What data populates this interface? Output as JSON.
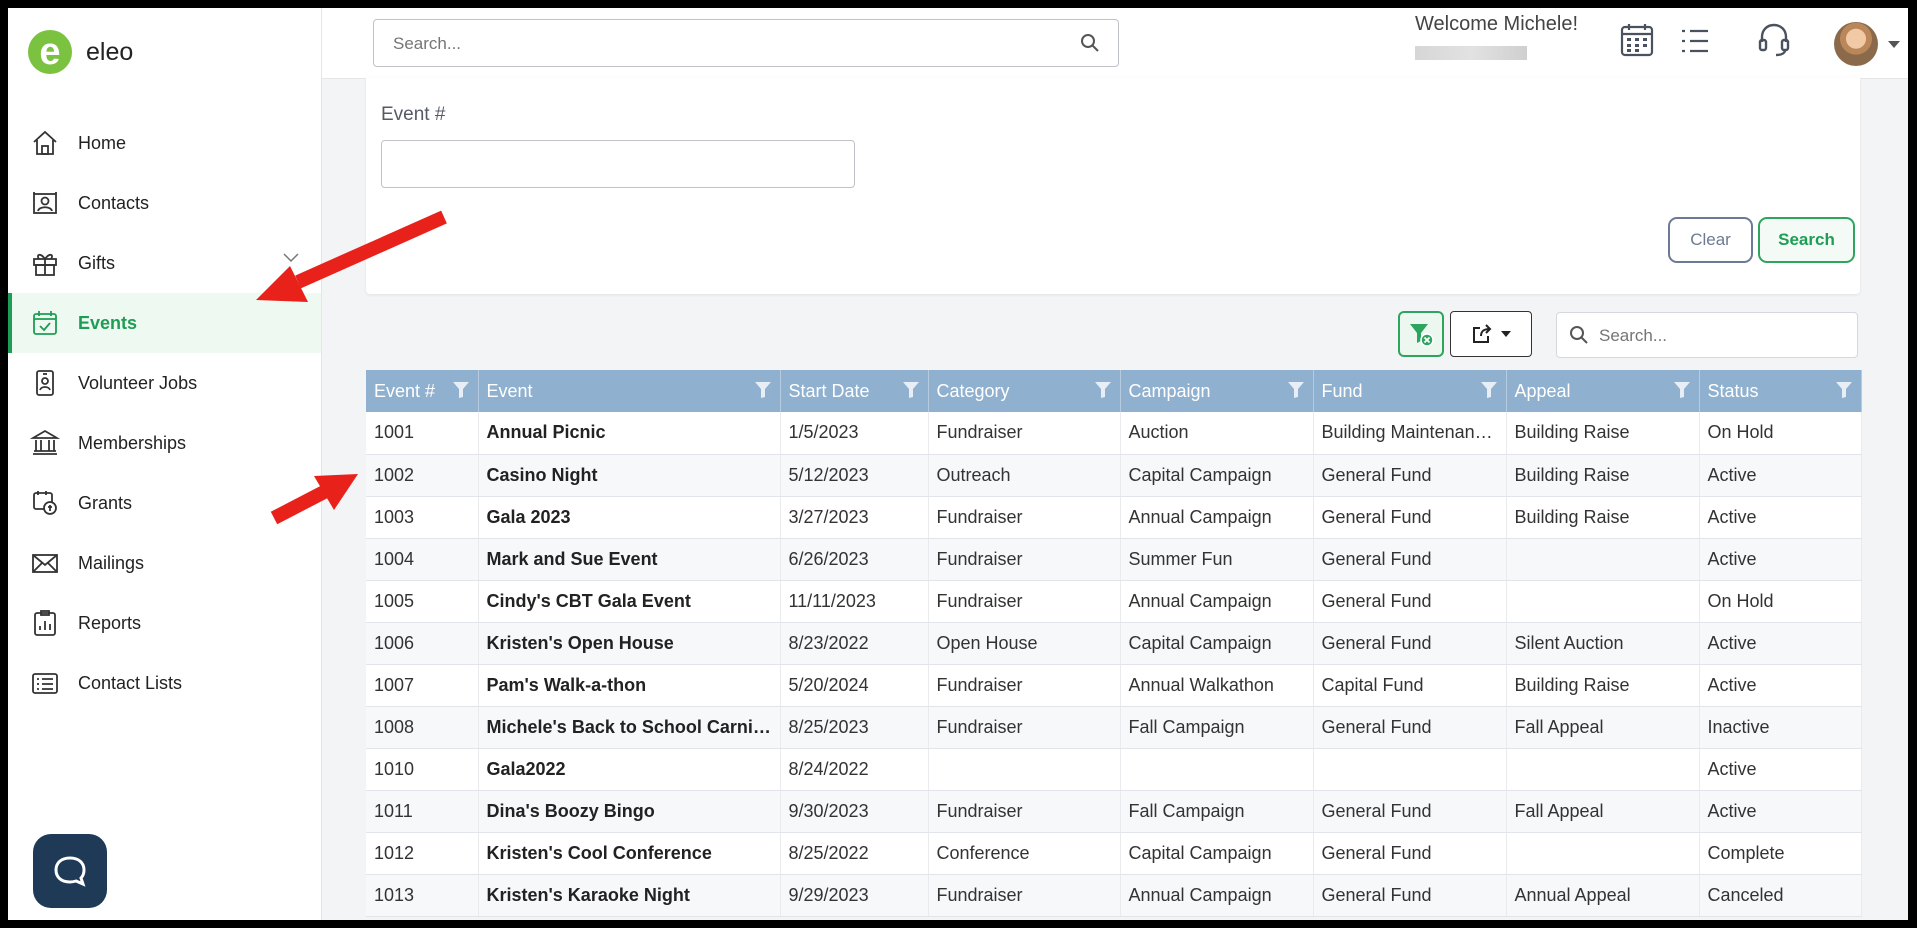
{
  "app": {
    "logo_text": "eleo",
    "logo_letter": "e"
  },
  "search": {
    "placeholder": "Search..."
  },
  "header": {
    "welcome": "Welcome Michele!"
  },
  "sidebar": {
    "items": [
      {
        "label": "Home",
        "icon": "home-icon"
      },
      {
        "label": "Contacts",
        "icon": "contacts-icon"
      },
      {
        "label": "Gifts",
        "icon": "gift-icon"
      },
      {
        "label": "Events",
        "icon": "calendar-check-icon",
        "active": true
      },
      {
        "label": "Volunteer Jobs",
        "icon": "badge-icon"
      },
      {
        "label": "Memberships",
        "icon": "bank-icon"
      },
      {
        "label": "Grants",
        "icon": "grant-icon"
      },
      {
        "label": "Mailings",
        "icon": "mail-icon"
      },
      {
        "label": "Reports",
        "icon": "report-icon"
      },
      {
        "label": "Contact Lists",
        "icon": "list-icon"
      }
    ]
  },
  "filter": {
    "event_label": "Event #",
    "event_value": "",
    "clear_label": "Clear",
    "search_label": "Search"
  },
  "grid_search": {
    "placeholder": "Search..."
  },
  "grid": {
    "columns": [
      "Event #",
      "Event",
      "Start Date",
      "Category",
      "Campaign",
      "Fund",
      "Appeal",
      "Status"
    ],
    "rows": [
      [
        "1001",
        "Annual Picnic",
        "1/5/2023",
        "Fundraiser",
        "Auction",
        "Building Maintenanc...",
        "Building Raise",
        "On Hold"
      ],
      [
        "1002",
        "Casino Night",
        "5/12/2023",
        "Outreach",
        "Capital Campaign",
        "General Fund",
        "Building Raise",
        "Active"
      ],
      [
        "1003",
        "Gala 2023",
        "3/27/2023",
        "Fundraiser",
        "Annual Campaign",
        "General Fund",
        "Building Raise",
        "Active"
      ],
      [
        "1004",
        "Mark and Sue Event",
        "6/26/2023",
        "Fundraiser",
        "Summer Fun",
        "General Fund",
        "",
        "Active"
      ],
      [
        "1005",
        "Cindy's CBT Gala Event",
        "11/11/2023",
        "Fundraiser",
        "Annual Campaign",
        "General Fund",
        "",
        "On Hold"
      ],
      [
        "1006",
        "Kristen's Open House",
        "8/23/2022",
        "Open House",
        "Capital Campaign",
        "General Fund",
        "Silent Auction",
        "Active"
      ],
      [
        "1007",
        "Pam's Walk-a-thon",
        "5/20/2024",
        "Fundraiser",
        "Annual Walkathon",
        "Capital Fund",
        "Building Raise",
        "Active"
      ],
      [
        "1008",
        "Michele's Back to School Carnival",
        "8/25/2023",
        "Fundraiser",
        "Fall Campaign",
        "General Fund",
        "Fall Appeal",
        "Inactive"
      ],
      [
        "1010",
        "Gala2022",
        "8/24/2022",
        "",
        "",
        "",
        "",
        "Active"
      ],
      [
        "1011",
        "Dina's Boozy Bingo",
        "9/30/2023",
        "Fundraiser",
        "Fall Campaign",
        "General Fund",
        "Fall Appeal",
        "Active"
      ],
      [
        "1012",
        "Kristen's Cool Conference",
        "8/25/2022",
        "Conference",
        "Capital Campaign",
        "General Fund",
        "",
        "Complete"
      ],
      [
        "1013",
        "Kristen's Karaoke Night",
        "9/29/2023",
        "Fundraiser",
        "Annual Campaign",
        "General Fund",
        "Annual Appeal",
        "Canceled"
      ]
    ]
  },
  "colors": {
    "accent": "#1f9d55",
    "header_bg": "#8fb0ce",
    "annotation_arrow": "#e8211b",
    "chat_button": "#1e3a56"
  }
}
